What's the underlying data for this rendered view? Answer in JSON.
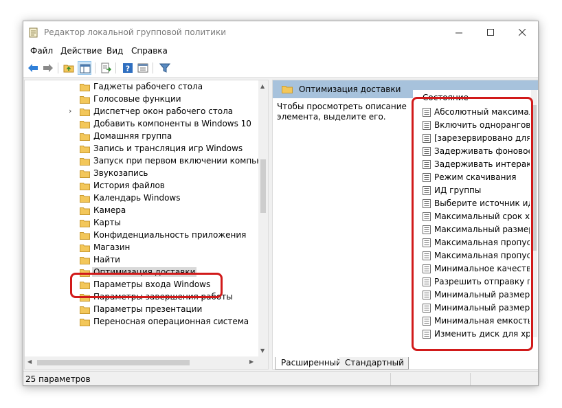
{
  "window": {
    "title": "Редактор локальной групповой политики"
  },
  "menu": {
    "items": [
      "Файл",
      "Действие",
      "Вид",
      "Справка"
    ]
  },
  "toolbar": {
    "icons": [
      "back-arrow-icon",
      "forward-arrow-icon",
      "up-folder-icon",
      "show-hide-tree-icon",
      "export-list-icon",
      "help-icon",
      "properties-icon",
      "filter-icon"
    ]
  },
  "tree": {
    "items": [
      {
        "label": "Гаджеты рабочего стола",
        "expandable": false
      },
      {
        "label": "Голосовые функции",
        "expandable": false
      },
      {
        "label": "Диспетчер окон рабочего стола",
        "expandable": true
      },
      {
        "label": "Добавить компоненты в Windows 10",
        "expandable": false
      },
      {
        "label": "Домашняя группа",
        "expandable": false
      },
      {
        "label": "Запись и трансляция игр Windows",
        "expandable": false
      },
      {
        "label": "Запуск при первом включении компьютера",
        "expandable": false
      },
      {
        "label": "Звукозапись",
        "expandable": false
      },
      {
        "label": "История файлов",
        "expandable": false
      },
      {
        "label": "Календарь Windows",
        "expandable": false
      },
      {
        "label": "Камера",
        "expandable": false
      },
      {
        "label": "Карты",
        "expandable": false
      },
      {
        "label": "Конфиденциальность приложения",
        "expandable": false
      },
      {
        "label": "Магазин",
        "expandable": false
      },
      {
        "label": "Найти",
        "expandable": false
      },
      {
        "label": "Оптимизация доставки",
        "expandable": false,
        "selected": true
      },
      {
        "label": "Параметры входа Windows",
        "expandable": false
      },
      {
        "label": "Параметры завершения работы",
        "expandable": false
      },
      {
        "label": "Параметры презентации",
        "expandable": false
      },
      {
        "label": "Переносная операционная система",
        "expandable": false
      }
    ]
  },
  "details": {
    "header": "Оптимизация доставки",
    "description": "Чтобы просмотреть описание элемента, выделите его.",
    "column_header": "Состояние",
    "items": [
      "Абсолютный максимальн",
      "Включить одноранговое",
      "[зарезервировано для ис",
      "Задерживать фоновое ск",
      "Задерживать интерактивн",
      "Режим скачивания",
      "ИД группы",
      "Выберите источник иден",
      "Максимальный срок хран",
      "Максимальный размер к",
      "Максимальная пропускн",
      "Максимальная пропускн",
      "Минимальное качество",
      "Разрешить отправку при",
      "Минимальный размер д",
      "Минимальный размер ф",
      "Минимальная емкость С",
      "Изменить диск для хране"
    ]
  },
  "tabs": {
    "extended": "Расширенный",
    "standard": "Стандартный"
  },
  "status": {
    "text": "25 параметров"
  },
  "colors": {
    "highlight": "#d11a1a",
    "details_header": "#a7c2dc",
    "folder": "#f3c75a"
  }
}
